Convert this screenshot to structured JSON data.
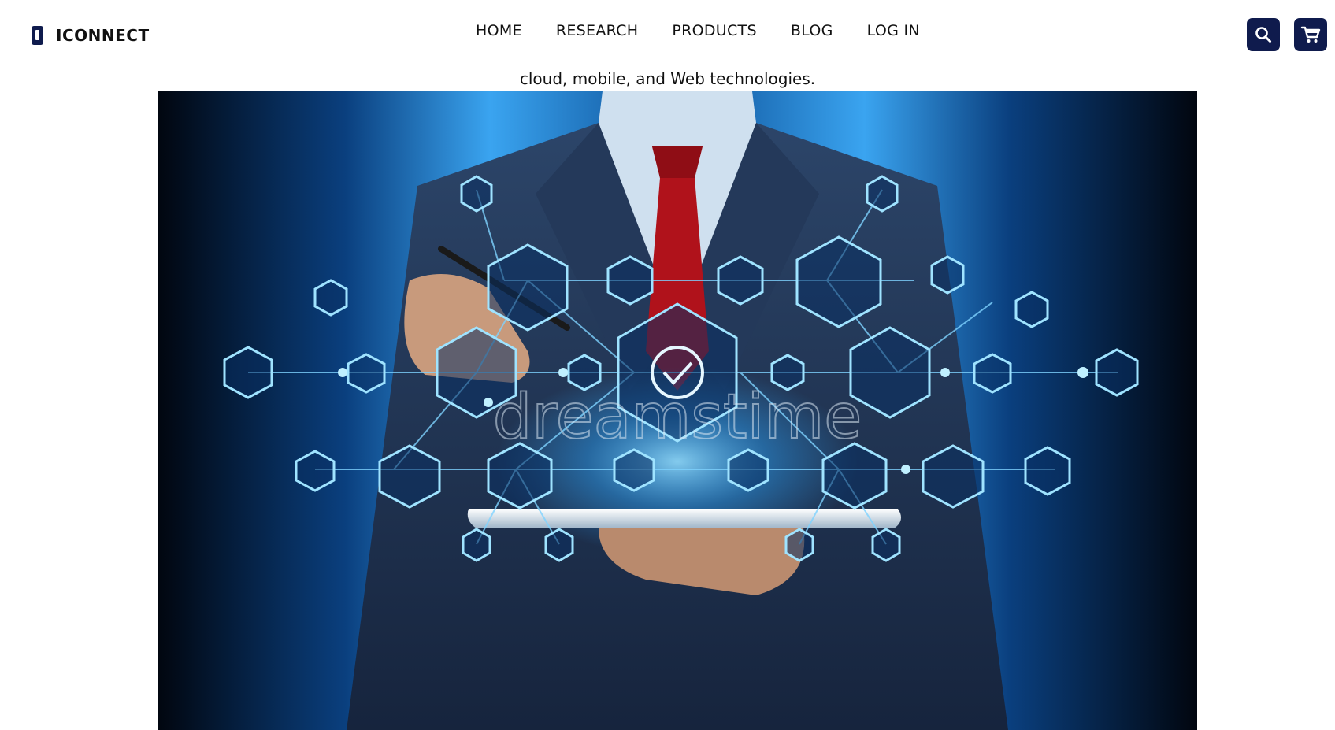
{
  "brand": {
    "name": "ICONNECT",
    "icon": "phone-icon",
    "color": "#0f1b4d"
  },
  "nav": {
    "items": [
      {
        "label": "HOME"
      },
      {
        "label": "RESEARCH"
      },
      {
        "label": "PRODUCTS"
      },
      {
        "label": "BLOG"
      },
      {
        "label": "LOG IN"
      }
    ]
  },
  "actions": {
    "search_icon": "search-icon",
    "cart_icon": "cart-icon",
    "accent": "#0f1b4d"
  },
  "content": {
    "tagline": "cloud, mobile, and Web technologies."
  },
  "hero": {
    "watermark": "dreamstime",
    "colors": {
      "background": "#061a3a",
      "glow": "#2ea8ff",
      "tie": "#b0121b"
    }
  }
}
